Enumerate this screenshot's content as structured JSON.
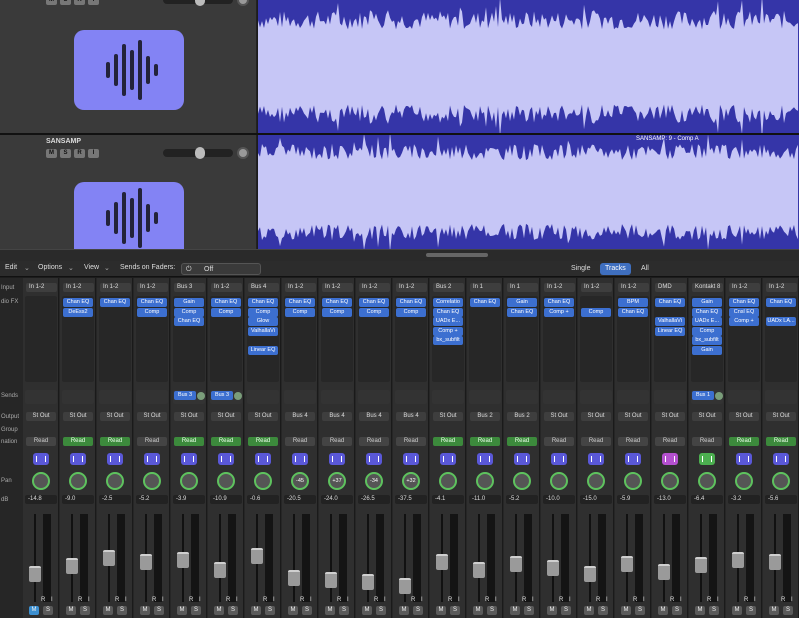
{
  "tracks": [
    {
      "name": "",
      "buttons": [
        "M",
        "S",
        "R",
        "I"
      ]
    },
    {
      "name": "SANSAMP",
      "buttons": [
        "M",
        "S",
        "R",
        "I"
      ]
    }
  ],
  "region_label": "SANSAMP: 9 - Comp A",
  "mixer_toolbar": {
    "edit": "Edit",
    "options": "Options",
    "view": "View",
    "sends_on_faders": "Sends on Faders:",
    "sends_value": "Off",
    "view_modes": [
      "Single",
      "Tracks",
      "All"
    ],
    "active_mode": "Tracks"
  },
  "row_labels": {
    "input": "Input",
    "audio_fx": "dio FX",
    "sends": "Sends",
    "output": "Output",
    "group": "Group",
    "automation": "nation",
    "pan": "Pan",
    "db": "dB"
  },
  "colors": {
    "accent": "#3f6fbf",
    "plugin": "#3c6fd0",
    "read_green": "#3c8a3c",
    "waveform_bg": "#3535a8",
    "artwork": "#8383f4"
  },
  "strips": [
    {
      "input": "In 1-2",
      "plugins": [],
      "sends": [],
      "output": "St Out",
      "read": "Read",
      "read_on": false,
      "pan": "",
      "db": "-14.8",
      "fader_level": 0.25,
      "icon": "waveform"
    },
    {
      "input": "In 1-2",
      "plugins": [
        "Chan EQ",
        "DeEss2"
      ],
      "sends": [],
      "output": "St Out",
      "read": "Read",
      "read_on": true,
      "pan": "",
      "db": "-9.0",
      "fader_level": 0.35,
      "icon": "waveform"
    },
    {
      "input": "In 1-2",
      "plugins": [
        "Chan EQ"
      ],
      "sends": [],
      "output": "St Out",
      "read": "Read",
      "read_on": true,
      "pan": "",
      "db": "-2.5",
      "fader_level": 0.45,
      "icon": "waveform"
    },
    {
      "input": "In 1-2",
      "plugins": [
        "Chan EQ",
        "Comp"
      ],
      "sends": [],
      "output": "St Out",
      "read": "Read",
      "read_on": false,
      "pan": "",
      "db": "-5.2",
      "fader_level": 0.4,
      "icon": "waveform"
    },
    {
      "input": "Bus 3",
      "plugins": [
        "Gain",
        "Comp",
        "Chan EQ"
      ],
      "sends": [
        "Bus 3"
      ],
      "output": "St Out",
      "read": "Read",
      "read_on": true,
      "pan": "",
      "db": "-3.9",
      "fader_level": 0.42,
      "icon": "waveform"
    },
    {
      "input": "In 1-2",
      "plugins": [
        "Chan EQ",
        "Comp"
      ],
      "sends": [
        "Bus 3"
      ],
      "output": "St Out",
      "read": "Read",
      "read_on": true,
      "pan": "",
      "db": "-10.9",
      "fader_level": 0.3,
      "icon": "waveform"
    },
    {
      "input": "Bus 4",
      "plugins": [
        "Chan EQ",
        "Comp",
        "Glow",
        "ValhallaVi",
        "",
        "Linear EQ"
      ],
      "sends": [],
      "output": "St Out",
      "read": "Read",
      "read_on": true,
      "pan": "",
      "db": "-0.6",
      "fader_level": 0.48,
      "icon": "clock"
    },
    {
      "input": "In 1-2",
      "plugins": [
        "Chan EQ",
        "Comp"
      ],
      "sends": [],
      "output": "Bus 4",
      "read": "Read",
      "read_on": false,
      "pan": "-45",
      "db": "-20.5",
      "fader_level": 0.2,
      "icon": "waveform"
    },
    {
      "input": "In 1-2",
      "plugins": [
        "Chan EQ",
        "Comp"
      ],
      "sends": [],
      "output": "Bus 4",
      "read": "Read",
      "read_on": false,
      "pan": "+37",
      "db": "-24.0",
      "fader_level": 0.17,
      "icon": "waveform"
    },
    {
      "input": "In 1-2",
      "plugins": [
        "Chan EQ",
        "Comp"
      ],
      "sends": [],
      "output": "Bus 4",
      "read": "Read",
      "read_on": false,
      "pan": "-34",
      "db": "-26.5",
      "fader_level": 0.15,
      "icon": "waveform"
    },
    {
      "input": "In 1-2",
      "plugins": [
        "Chan EQ",
        "Comp"
      ],
      "sends": [],
      "output": "Bus 4",
      "read": "Read",
      "read_on": false,
      "pan": "+32",
      "db": "-37.5",
      "fader_level": 0.1,
      "icon": "waveform"
    },
    {
      "input": "Bus 2",
      "plugins": [
        "Correlatio",
        "Chan EQ",
        "UADx E...",
        "Comp +",
        "bx_subfilt"
      ],
      "sends": [],
      "output": "St Out",
      "read": "Read",
      "read_on": true,
      "pan": "",
      "db": "-4.1",
      "fader_level": 0.4,
      "icon": "clock"
    },
    {
      "input": "In 1",
      "plugins": [
        "Chan EQ"
      ],
      "sends": [],
      "output": "Bus 2",
      "read": "Read",
      "read_on": true,
      "pan": "",
      "db": "-11.0",
      "fader_level": 0.3,
      "icon": "waveform"
    },
    {
      "input": "In 1",
      "plugins": [
        "Gain",
        "Chan EQ"
      ],
      "sends": [],
      "output": "Bus 2",
      "read": "Read",
      "read_on": true,
      "pan": "",
      "db": "-5.2",
      "fader_level": 0.38,
      "icon": "waveform"
    },
    {
      "input": "In 1-2",
      "plugins": [
        "Chan EQ",
        "Comp +"
      ],
      "sends": [],
      "output": "St Out",
      "read": "Read",
      "read_on": false,
      "pan": "",
      "db": "-10.0",
      "fader_level": 0.32,
      "icon": "waveform"
    },
    {
      "input": "In 1-2",
      "plugins": [
        "",
        "Comp"
      ],
      "sends": [],
      "output": "St Out",
      "read": "Read",
      "read_on": false,
      "pan": "",
      "db": "-15.0",
      "fader_level": 0.25,
      "icon": "waveform"
    },
    {
      "input": "In 1-2",
      "plugins": [
        "BPM",
        "Chan EQ"
      ],
      "sends": [],
      "output": "St Out",
      "read": "Read",
      "read_on": false,
      "pan": "",
      "db": "-5.9",
      "fader_level": 0.38,
      "icon": "waveform"
    },
    {
      "input": "DMD",
      "plugins": [
        "Chan EQ",
        "",
        "ValhallaVi",
        "Linear EQ"
      ],
      "sends": [],
      "output": "St Out",
      "read": "Read",
      "read_on": false,
      "pan": "",
      "db": "-13.0",
      "fader_level": 0.27,
      "icon": "keyboard"
    },
    {
      "input": "Kontakt 8",
      "plugins": [
        "Gain",
        "Chan EQ",
        "UADx E...",
        "Comp",
        "bx_subfilt",
        "Gain"
      ],
      "sends": [
        "Bus 1"
      ],
      "output": "St Out",
      "read": "Read",
      "read_on": false,
      "pan": "",
      "db": "-6.4",
      "fader_level": 0.36,
      "icon": "music"
    },
    {
      "input": "In 1-2",
      "plugins": [
        "Chan EQ",
        "Cnsl EQ",
        "Comp +"
      ],
      "sends": [],
      "output": "St Out",
      "read": "Read",
      "read_on": true,
      "pan": "",
      "db": "-3.2",
      "fader_level": 0.43,
      "icon": "waveform"
    },
    {
      "input": "In 1-2",
      "plugins": [
        "Chan EQ",
        "",
        "UADx LA..."
      ],
      "sends": [],
      "output": "St Out",
      "read": "Read",
      "read_on": true,
      "pan": "",
      "db": "-5.6",
      "fader_level": 0.4,
      "icon": "waveform"
    }
  ]
}
